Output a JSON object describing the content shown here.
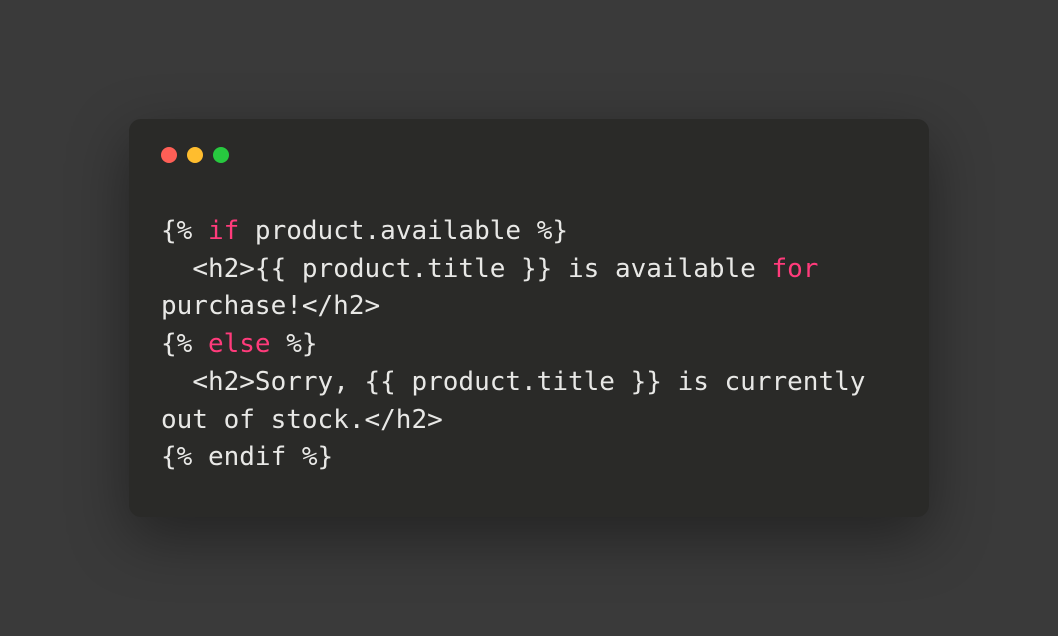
{
  "code": {
    "line1_open": "{% ",
    "line1_keyword": "if",
    "line1_rest": " product.available %}",
    "line2_part1": "  <h2>{{ product.title }} is available ",
    "line2_keyword": "for",
    "line2_part2": " purchase!</h2>",
    "line3_open": "{% ",
    "line3_keyword": "else",
    "line3_rest": " %}",
    "line4": "  <h2>Sorry, {{ product.title }} is currently out of stock.</h2>",
    "line5": "{% endif %}"
  },
  "window": {
    "traffic_lights": [
      "red",
      "yellow",
      "green"
    ]
  }
}
